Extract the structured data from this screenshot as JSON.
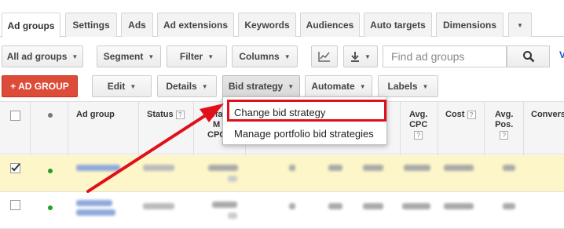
{
  "tabs": [
    {
      "label": "Ad groups",
      "active": true
    },
    {
      "label": "Settings"
    },
    {
      "label": "Ads"
    },
    {
      "label": "Ad extensions"
    },
    {
      "label": "Keywords"
    },
    {
      "label": "Audiences"
    },
    {
      "label": "Auto targets"
    },
    {
      "label": "Dimensions"
    }
  ],
  "toolbar1": {
    "filter_scope": "All ad groups",
    "segment": "Segment",
    "filter": "Filter",
    "columns": "Columns",
    "search_placeholder": "Find ad groups",
    "edge_char": "V"
  },
  "toolbar2": {
    "add": "+ AD GROUP",
    "edit": "Edit",
    "details": "Details",
    "bid_strategy": "Bid strategy",
    "automate": "Automate",
    "labels": "Labels"
  },
  "table": {
    "headers": {
      "ad_group": "Ad group",
      "status": "Status",
      "default_max_cpc_partial": [
        "efa",
        "M",
        "CPC"
      ],
      "avg_cpc": [
        "Avg.",
        "CPC"
      ],
      "cost": "Cost",
      "avg_pos": [
        "Avg.",
        "Pos."
      ],
      "conversions": "Convers"
    },
    "rows": [
      {
        "checked": true,
        "status_color": "#1fa21f"
      },
      {
        "checked": false,
        "status_color": "#1fa21f"
      }
    ]
  },
  "dropdown": {
    "items": [
      "Change bid strategy",
      "Manage portfolio bid strategies"
    ]
  },
  "colors": {
    "accent_red": "#dd4b39",
    "highlight_red": "#e0101b",
    "selected_row": "#fdf6c8",
    "enabled_green": "#1fa21f"
  }
}
